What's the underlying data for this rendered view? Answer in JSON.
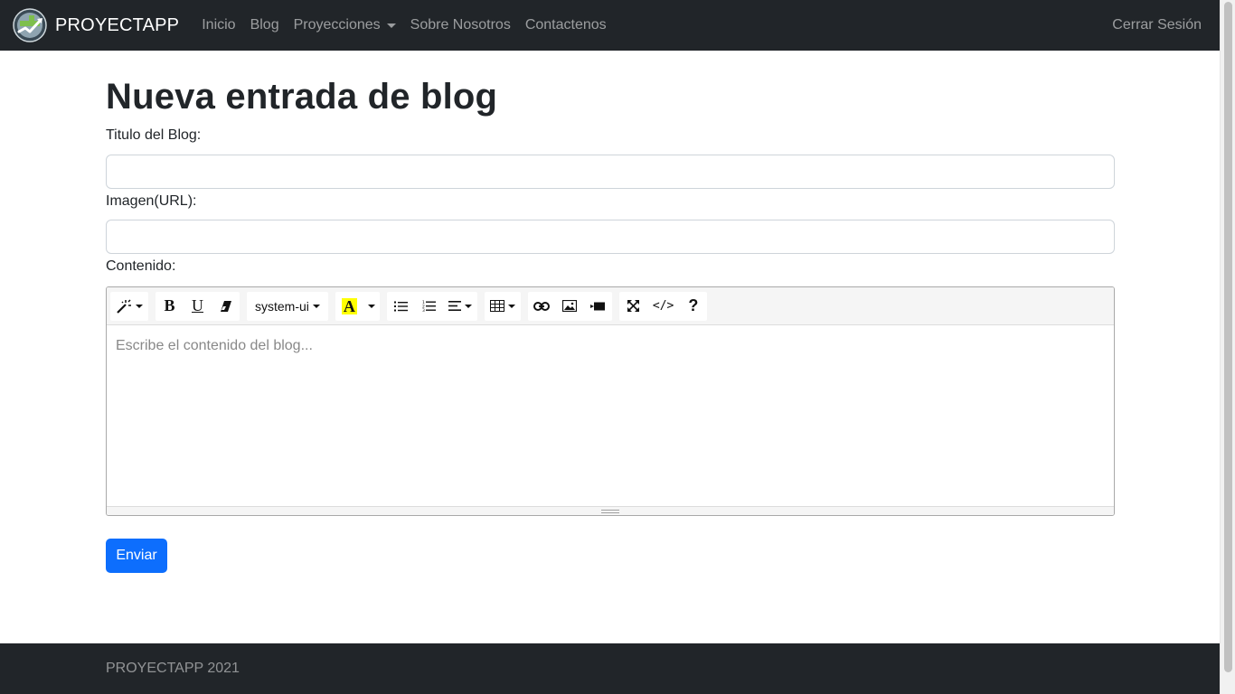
{
  "navbar": {
    "brand": "PROYECTAPP",
    "items": [
      {
        "label": "Inicio"
      },
      {
        "label": "Blog"
      },
      {
        "label": "Proyecciones"
      },
      {
        "label": "Sobre Nosotros"
      },
      {
        "label": "Contactenos"
      }
    ],
    "logout": "Cerrar Sesión"
  },
  "page": {
    "title": "Nueva entrada de blog"
  },
  "form": {
    "title_label": "Titulo del Blog:",
    "title_value": "",
    "image_label": "Imagen(URL):",
    "image_value": "",
    "content_label": "Contenido:",
    "content_placeholder": "Escribe el contenido del blog...",
    "submit_label": "Enviar"
  },
  "editor": {
    "font_name": "system-ui",
    "highlight_color": "#ffff00",
    "toolbar_icons": [
      "magic-style-icon",
      "bold-icon",
      "underline-icon",
      "eraser-icon",
      "font-family-select",
      "text-color-icon",
      "unordered-list-icon",
      "ordered-list-icon",
      "align-icon",
      "table-icon",
      "link-icon",
      "picture-icon",
      "video-icon",
      "fullscreen-icon",
      "code-view-icon",
      "help-icon"
    ]
  },
  "footer": {
    "text": "PROYECTAPP 2021"
  },
  "colors": {
    "navbar_bg": "#212529",
    "primary": "#0d6efd"
  }
}
